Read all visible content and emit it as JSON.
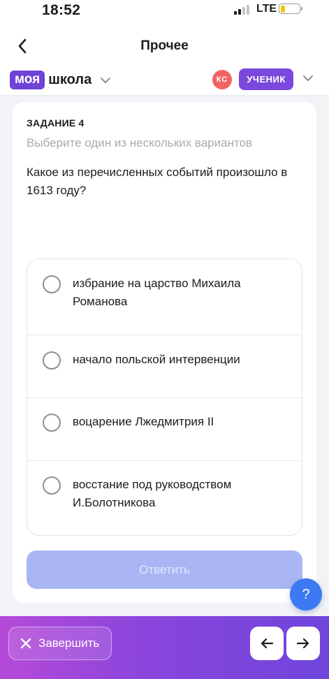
{
  "status_bar": {
    "time": "18:52",
    "network": "LTE",
    "battery_level": 0.25
  },
  "nav": {
    "title": "Прочее"
  },
  "brand": {
    "logo_box": "моя",
    "logo_text": "школа",
    "avatar_initials": "КС",
    "role": "УЧЕНИК"
  },
  "task": {
    "label": "ЗАДАНИЕ 4",
    "hint": "Выберите один из нескольких вариантов",
    "question": "Какое из перечисленных событий произошло в 1613 году?",
    "options": [
      {
        "text": "избрание на царство Михаила Романова",
        "selected": false
      },
      {
        "text": "начало польской интервенции",
        "selected": false
      },
      {
        "text": "воцарение Лжедмитрия II",
        "selected": false
      },
      {
        "text": "восстание под руководством И.Болотникова",
        "selected": false
      }
    ],
    "submit_label": "Ответить"
  },
  "help": {
    "label": "?"
  },
  "footer": {
    "finish_label": "Завершить"
  },
  "colors": {
    "brand_purple": "#6e43d6",
    "submit_disabled": "#aab6f4",
    "help_blue": "#3d79f2",
    "avatar_red": "#f26464"
  }
}
